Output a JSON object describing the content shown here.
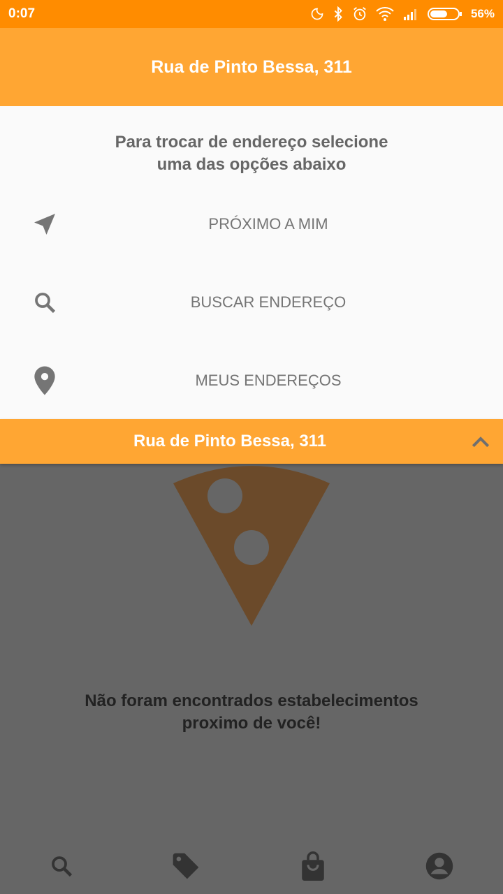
{
  "status_bar": {
    "time": "0:07",
    "battery": "56%",
    "icons": [
      "moon-icon",
      "bluetooth-icon",
      "alarm-icon",
      "wifi-icon",
      "signal-icon",
      "battery-icon"
    ]
  },
  "header": {
    "title": "Rua de Pinto Bessa, 311"
  },
  "panel": {
    "title_line1": "Para trocar de endereço selecione",
    "title_line2": "uma das opções abaixo",
    "options": [
      {
        "label": "PRÓXIMO A MIM",
        "icon": "navigation-arrow-icon"
      },
      {
        "label": "BUSCAR ENDEREÇO",
        "icon": "search-icon"
      },
      {
        "label": "MEUS ENDEREÇOS",
        "icon": "location-pin-icon"
      }
    ]
  },
  "address_bar": {
    "address": "Rua de Pinto Bessa, 311",
    "icon": "chevron-up-icon"
  },
  "main": {
    "empty_line1": "Não foram encontrados estabelecimentos",
    "empty_line2": "proximo de você!"
  },
  "bottom_nav": {
    "items": [
      "search-icon",
      "tag-icon",
      "shopping-bag-icon",
      "account-icon"
    ]
  },
  "colors": {
    "status_bar": "#FF8C00",
    "accent": "#FFA633",
    "overlay": "#666666",
    "pizza": "#6B4A2A"
  }
}
